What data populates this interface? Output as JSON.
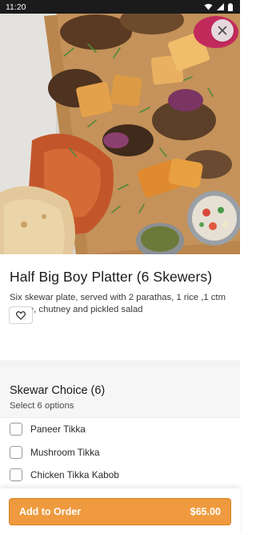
{
  "status_bar": {
    "time": "11:20",
    "icons": [
      "wifi-icon",
      "cellular-signal-icon",
      "battery-icon"
    ]
  },
  "hero": {
    "image": "mixed-grill-platter-photo",
    "close_icon": "close-icon"
  },
  "product": {
    "title": "Half Big Boy Platter (6 Skewers)",
    "description": "Six skewar plate, served with 2 parathas, 1 rice ,1 ctm sauce, chutney and pickled salad",
    "favorite_icon": "heart-outline-icon"
  },
  "options_section": {
    "title": "Skewar Choice (6)",
    "subtitle": "Select 6 options",
    "options": [
      {
        "label": "Paneer Tikka",
        "checked": false
      },
      {
        "label": "Mushroom Tikka",
        "checked": false
      },
      {
        "label": "Chicken Tikka Kabob",
        "checked": false
      }
    ]
  },
  "footer": {
    "button_label": "Add to Order",
    "price": "$65.00"
  },
  "colors": {
    "accent": "#ef9a3e",
    "status_bar": "#1b1b1b",
    "section_bg": "#f6f6f6"
  }
}
